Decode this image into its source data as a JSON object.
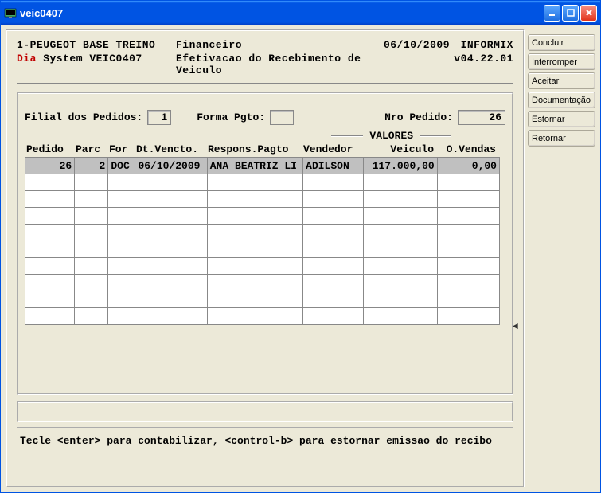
{
  "window": {
    "title": "veic0407"
  },
  "header": {
    "company": "1-PEUGEOT BASE TREINO",
    "module": "Financeiro",
    "date": "06/10/2009",
    "db": "INFORMIX",
    "dia_prefix": "Dia",
    "system_code": " System  VEIC0407",
    "screen_title": "Efetivacao do Recebimento de Veiculo",
    "version": "v04.22.01"
  },
  "filters": {
    "filial_label": "Filial dos Pedidos:",
    "filial_value": "1",
    "forma_label": "Forma Pgto:",
    "forma_value": "",
    "nro_label": "Nro Pedido:",
    "nro_value": "26"
  },
  "valores_label": "VALORES",
  "columns": {
    "c1": "Pedido",
    "c2": "Parc",
    "c3": "For",
    "c4": "Dt.Vencto.",
    "c5": "Respons.Pagto",
    "c6": "Vendedor",
    "c7": "Veiculo",
    "c8": "O.Vendas"
  },
  "rows": [
    {
      "pedido": "26",
      "parc": "2",
      "for": "DOC",
      "dtvencto": "06/10/2009",
      "respons": "ANA BEATRIZ LI",
      "vendedor": "ADILSON",
      "veiculo": "117.000,00",
      "ovendas": "0,00"
    }
  ],
  "empty_rows": 9,
  "hint": "Tecle <enter> para contabilizar, <control-b> para estornar emissao do recibo",
  "side_buttons": [
    "Concluir",
    "Interromper",
    "Aceitar",
    "Documentação",
    "Estornar",
    "Retornar"
  ]
}
